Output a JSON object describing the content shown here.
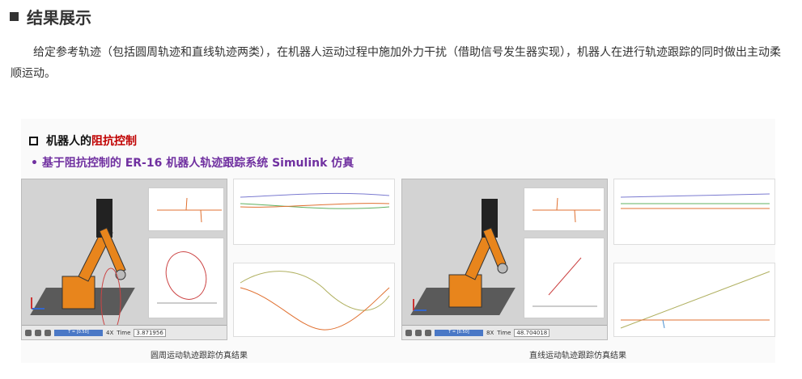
{
  "heading": "结果展示",
  "intro": "给定参考轨迹（包括圆周轨迹和直线轨迹两类），在机器人运动过程中施加外力干扰（借助信号发生器实现），机器人在进行轨迹跟踪的同时做出主动柔顺运动。",
  "figure": {
    "title_prefix": "机器人的",
    "title_highlight": "阻抗控制",
    "subtitle": "•  基于阻抗控制的 ER-16 机器人轨迹跟踪系统 Simulink 仿真",
    "left": {
      "speed": "4X",
      "time_label": "Time",
      "time_value": "3.871956",
      "progress": "T = [0.50]",
      "caption": "圆周运动轨迹跟踪仿真结果"
    },
    "right": {
      "speed": "8X",
      "time_label": "Time",
      "time_value": "48.704018",
      "progress": "T = [0.50]",
      "caption": "直线运动轨迹跟踪仿真结果"
    }
  },
  "colors": {
    "robot": "#e8851c",
    "highlight": "#c00000",
    "subtitle": "#7030a0"
  }
}
